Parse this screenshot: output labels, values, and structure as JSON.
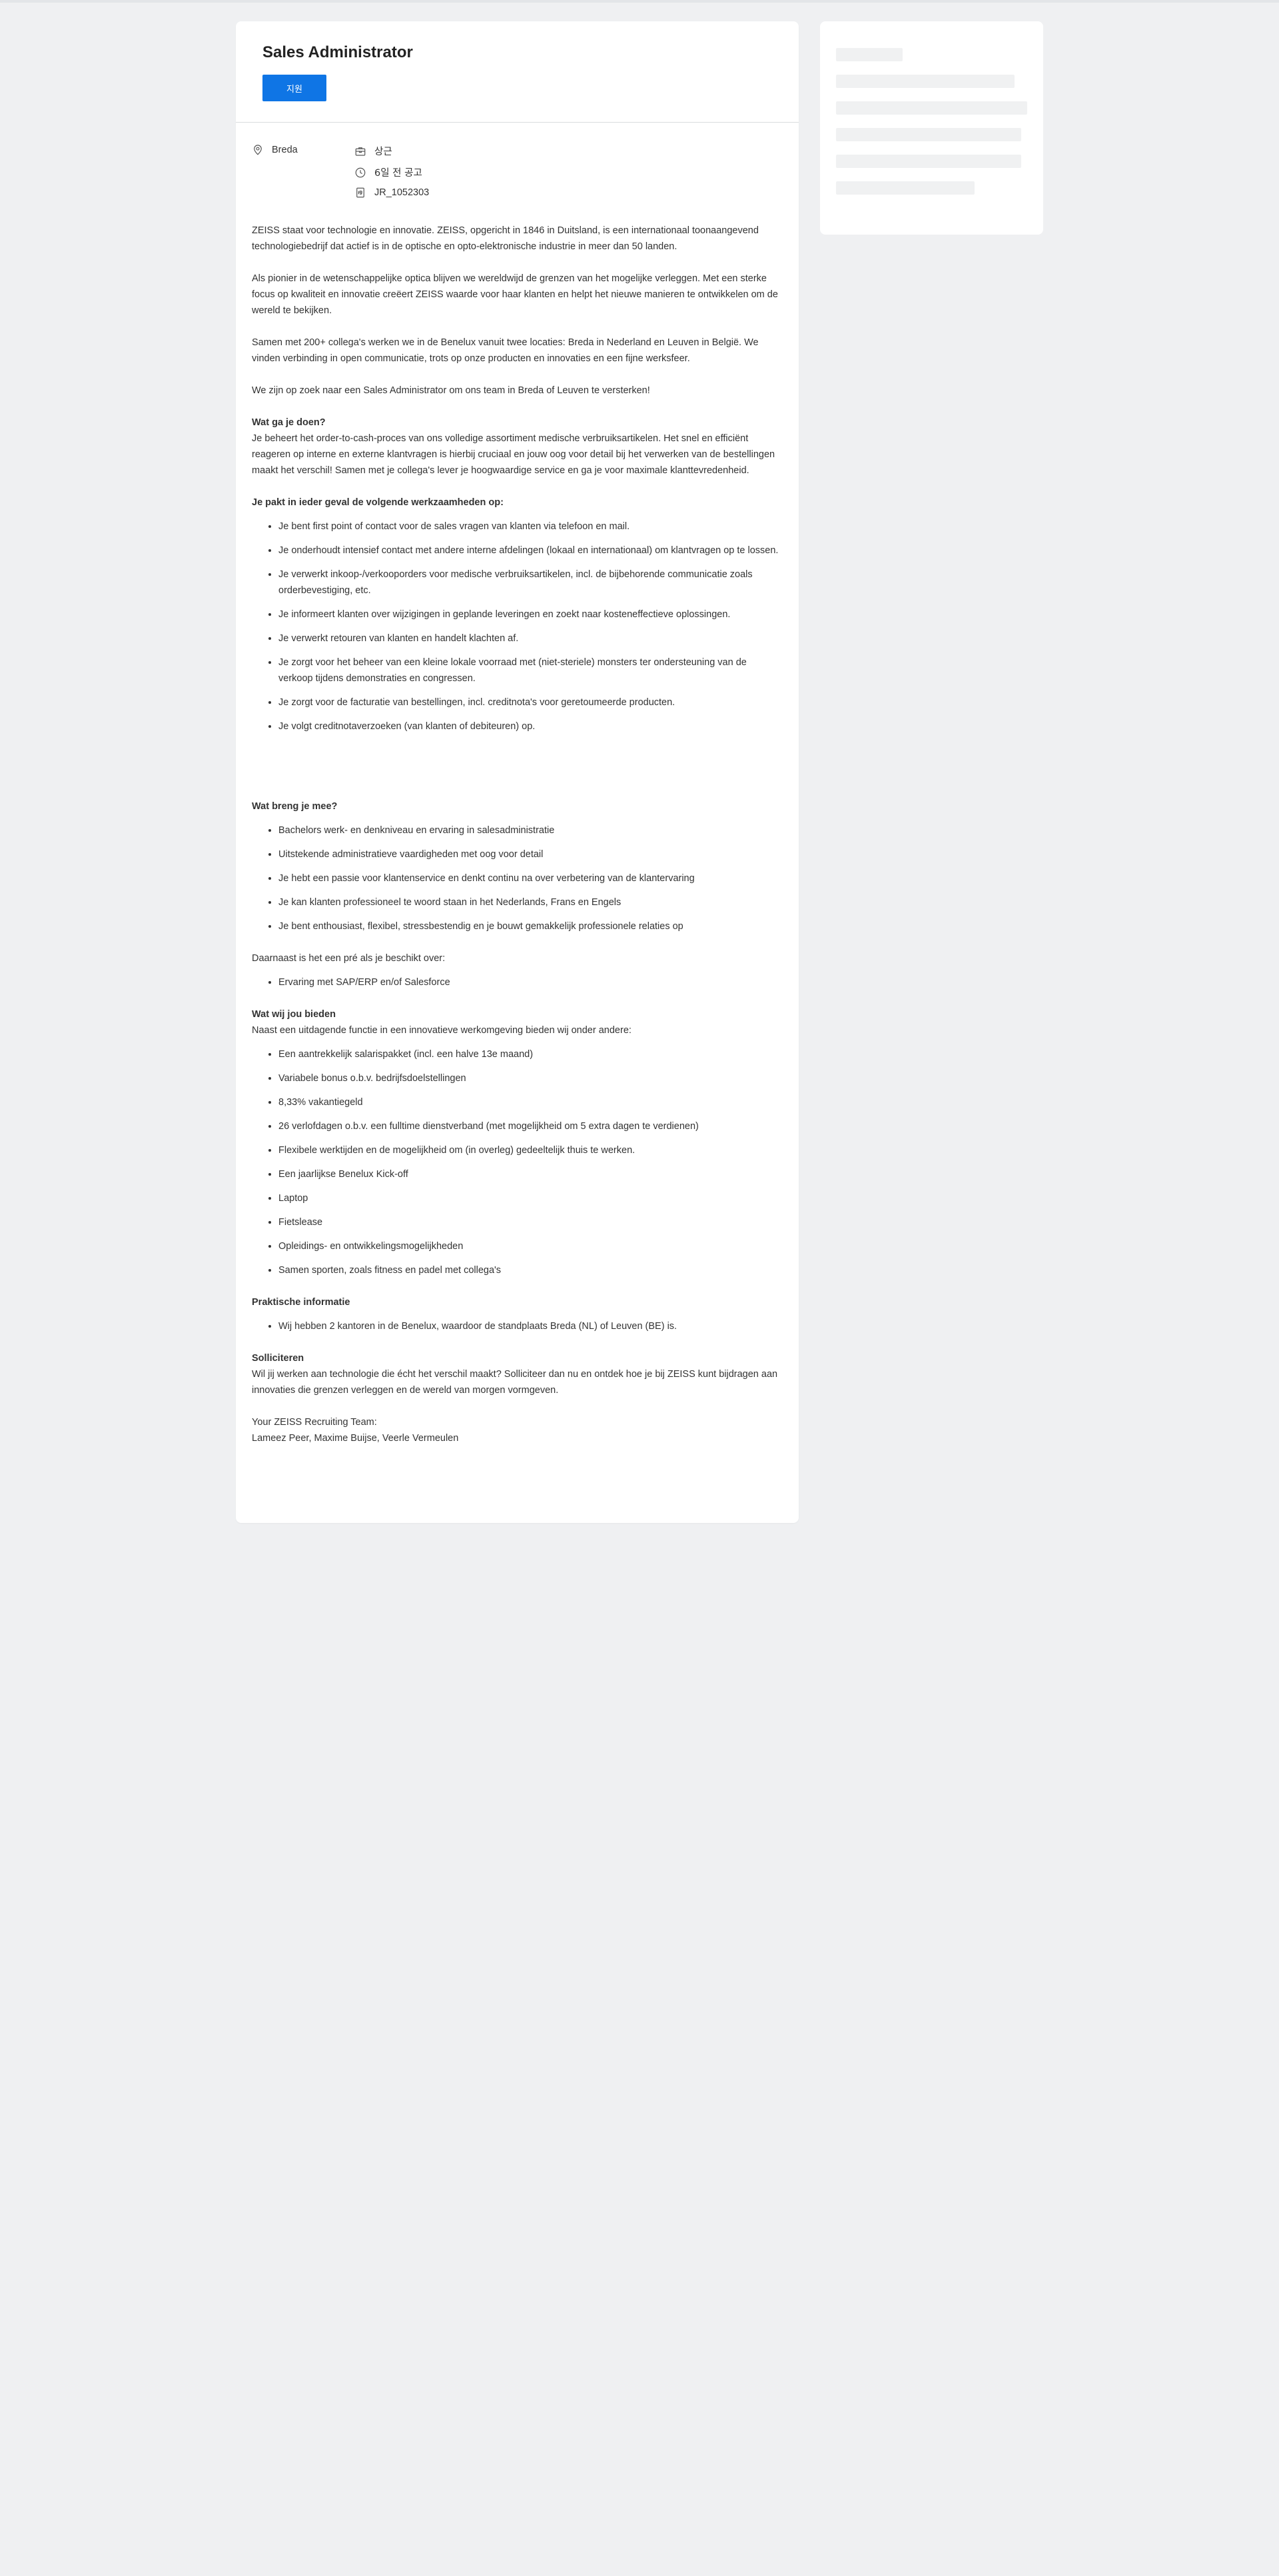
{
  "job": {
    "title": "Sales Administrator",
    "apply_label": "지원",
    "location": "Breda",
    "type": "상근",
    "posted": "6일 전 공고",
    "req_id": "JR_1052303"
  },
  "icons": {
    "location": "map-pin-icon",
    "type": "briefcase-icon",
    "posted": "clock-icon",
    "req_id": "document-id-icon"
  },
  "colors": {
    "accent": "#0f75e5",
    "background": "#eff0f2",
    "card": "#ffffff",
    "skeleton": "#f0f1f2"
  },
  "description": {
    "intro1": "ZEISS staat voor technologie en innovatie. ZEISS, opgericht in 1846 in Duitsland, is een internationaal toonaangevend technologiebedrijf dat actief is in de optische en opto-elektronische industrie in meer dan 50 landen.",
    "intro2": "Als pionier in de wetenschappelijke optica blijven we wereldwijd de grenzen van het mogelijke verleggen. Met een sterke focus op kwaliteit en innovatie creëert ZEISS waarde voor haar klanten en helpt het nieuwe manieren te ontwikkelen om de wereld te bekijken.",
    "intro3": "Samen met 200+ collega's werken we in de Benelux vanuit twee locaties: Breda in Nederland en Leuven in België. We vinden verbinding in open communicatie, trots op onze producten en innovaties en een fijne werksfeer.",
    "intro4": "We zijn op zoek naar een Sales Administrator om ons team in Breda of Leuven te versterken!",
    "what_heading": "Wat ga je doen?",
    "what_text": "Je beheert het order-to-cash-proces van ons volledige assortiment medische verbruiksartikelen. Het snel en efficiënt reageren op interne en externe klantvragen is hierbij cruciaal en jouw oog voor detail bij het verwerken van de bestellingen maakt het verschil! Samen met je collega's lever je hoogwaardige service en ga je voor maximale klanttevredenheid.",
    "tasks_heading": "Je pakt in ieder geval de volgende werkzaamheden op:",
    "tasks": [
      "Je bent first point of contact voor de sales vragen van klanten via telefoon en mail.",
      "Je onderhoudt intensief contact met andere interne afdelingen (lokaal en internationaal) om klantvragen op te lossen.",
      "Je verwerkt inkoop-/verkooporders voor medische verbruiksartikelen, incl. de bijbehorende communicatie zoals orderbevestiging, etc.",
      "Je informeert klanten over wijzigingen in geplande leveringen en zoekt naar kosteneffectieve oplossingen.",
      "Je verwerkt retouren van klanten en handelt klachten af.",
      "Je zorgt voor het beheer van een kleine lokale voorraad met (niet-steriele) monsters ter ondersteuning van de verkoop tijdens demonstraties en congressen.",
      "Je zorgt voor de facturatie van bestellingen, incl. creditnota's voor geretoumeerde producten.",
      "Je volgt creditnotaverzoeken (van klanten of debiteuren) op."
    ],
    "bring_heading": "Wat breng je mee?",
    "bring": [
      "Bachelors werk- en denkniveau en ervaring in salesadministratie",
      "Uitstekende administratieve vaardigheden met oog voor detail",
      "Je hebt een passie voor klantenservice en denkt continu na over verbetering van de klantervaring",
      "Je kan klanten professioneel te woord staan in het Nederlands, Frans en Engels",
      "Je bent enthousiast, flexibel, stressbestendig en je bouwt gemakkelijk professionele relaties op"
    ],
    "plus_text": "Daarnaast is het een pré als je beschikt over:",
    "plus": [
      "Ervaring met SAP/ERP en/of Salesforce"
    ],
    "offer_heading": "Wat wij jou bieden",
    "offer_text": "Naast een uitdagende functie in een innovatieve werkomgeving bieden wij onder andere:",
    "offer": [
      "Een aantrekkelijk salarispakket (incl. een halve 13e maand)",
      "Variabele bonus o.b.v. bedrijfsdoelstellingen",
      "8,33% vakantiegeld",
      "26 verlofdagen o.b.v. een fulltime dienstverband (met mogelijkheid om 5 extra dagen te verdienen)",
      "Flexibele werktijden en de mogelijkheid om (in overleg) gedeeltelijk thuis te werken.",
      "Een jaarlijkse Benelux Kick-off",
      "Laptop",
      "Fietslease",
      "Opleidings- en ontwikkelingsmogelijkheden",
      "Samen sporten, zoals fitness en padel met collega's"
    ],
    "practical_heading": "Praktische informatie",
    "practical": [
      "Wij hebben 2 kantoren in de Benelux, waardoor de standplaats Breda (NL) of Leuven (BE) is."
    ],
    "apply_heading": "Solliciteren",
    "apply_text": "Wil jij werken aan technologie die écht het verschil maakt? Solliciteer dan nu en ontdek hoe je bij ZEISS kunt bijdragen aan innovaties die grenzen verleggen en de wereld van morgen vormgeven.",
    "team_line1": "Your ZEISS Recruiting Team:",
    "team_line2": "Lameez Peer, Maxime Buijse, Veerle Vermeulen"
  }
}
